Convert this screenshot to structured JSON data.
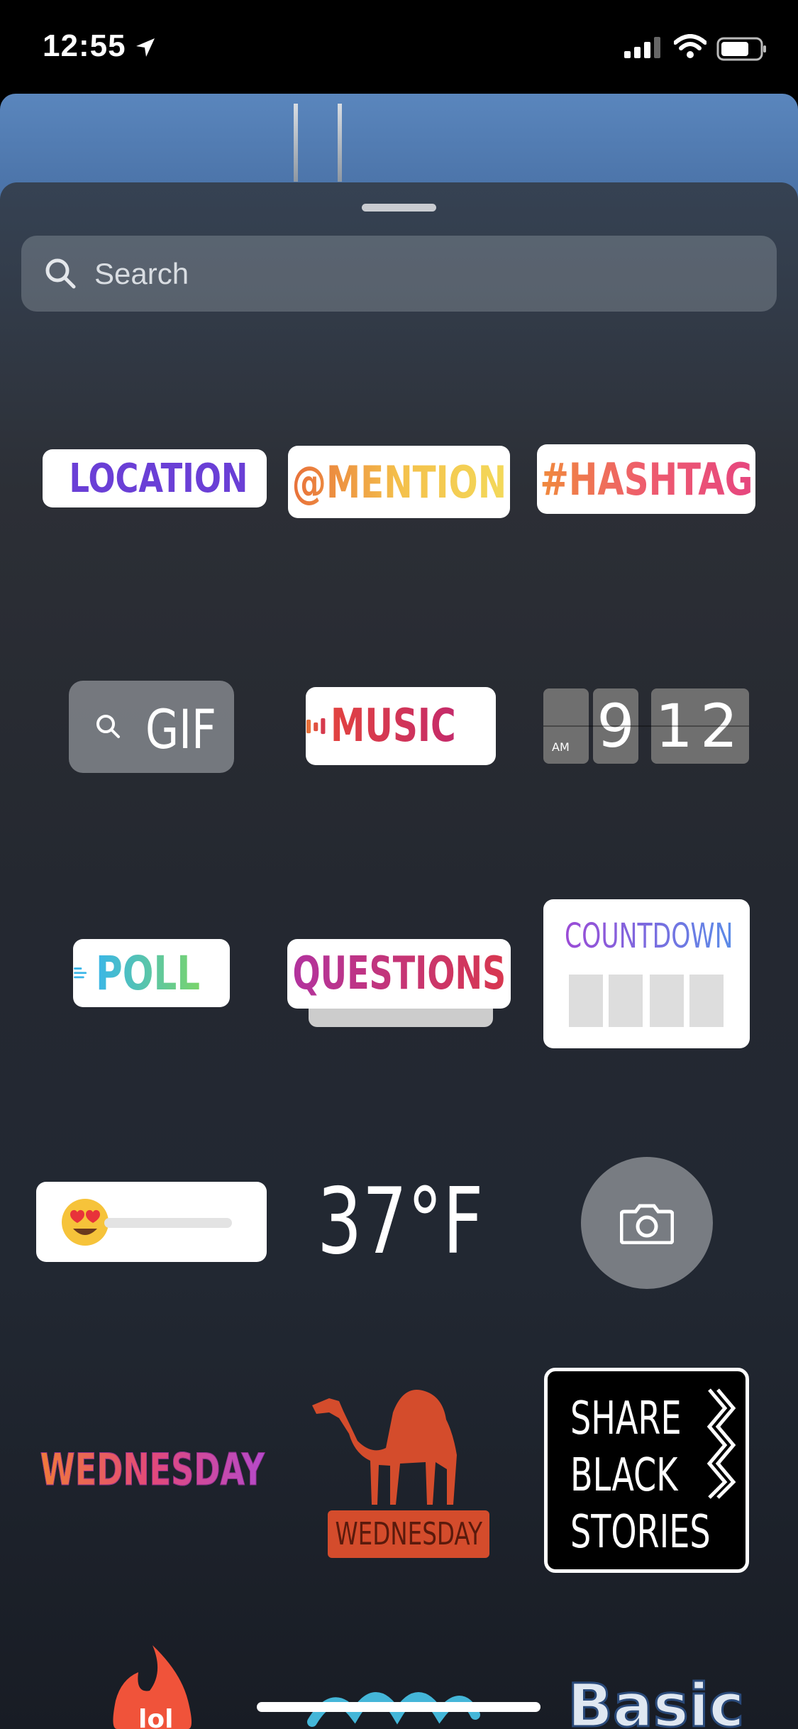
{
  "status": {
    "time": "12:55"
  },
  "search": {
    "placeholder": "Search"
  },
  "stickers": {
    "location": "LOCATION",
    "mention": "@MENTION",
    "hashtag": "#HASHTAG",
    "gif": "GIF",
    "music": "MUSIC",
    "clock": {
      "ampm": "AM",
      "hour": "9",
      "minute": "12"
    },
    "poll": "POLL",
    "questions": "QUESTIONS",
    "countdown": "COUNTDOWN",
    "temperature": "37°F",
    "wednesday": "WEDNESDAY",
    "camel_label": "WEDNESDAY",
    "share_black_stories": [
      "SHARE",
      "BLACK",
      "STORIES"
    ],
    "basic": "Basic"
  },
  "colors": {
    "location": "#7b3fd1",
    "poll_start": "#3ab6e8",
    "poll_end": "#7ad46a",
    "camel": "#d44c2c"
  }
}
